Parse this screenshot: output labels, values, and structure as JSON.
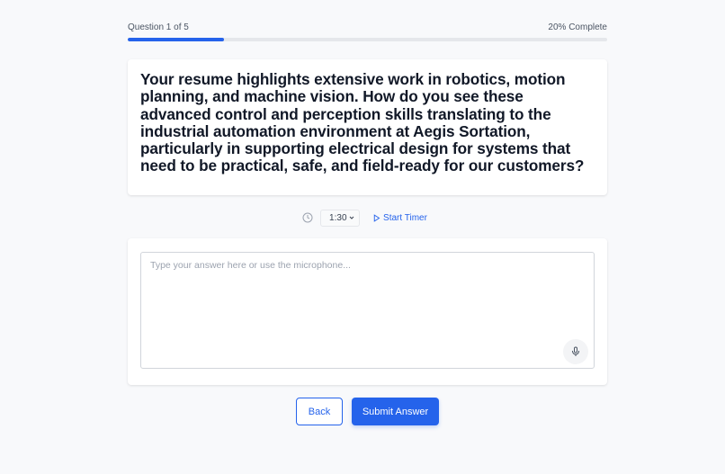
{
  "progress": {
    "question_label": "Question 1 of 5",
    "complete_label": "20% Complete",
    "fraction": 0.2
  },
  "question": {
    "text": "Your resume highlights extensive work in robotics, motion planning, and machine vision. How do you see these advanced control and perception skills translating to the industrial automation environment at Aegis Sortation, particularly in supporting electrical design for systems that need to be practical, safe, and field-ready for our customers?"
  },
  "timer": {
    "icon": "clock-icon",
    "selected": "1:30",
    "start_label": "Start Timer"
  },
  "answer": {
    "placeholder": "Type your answer here or use the microphone...",
    "value": "",
    "mic_icon": "microphone-icon"
  },
  "actions": {
    "back_label": "Back",
    "submit_label": "Submit Answer"
  },
  "colors": {
    "accent": "#2563eb",
    "background": "#f8f9fb",
    "track": "#e5e7eb"
  }
}
